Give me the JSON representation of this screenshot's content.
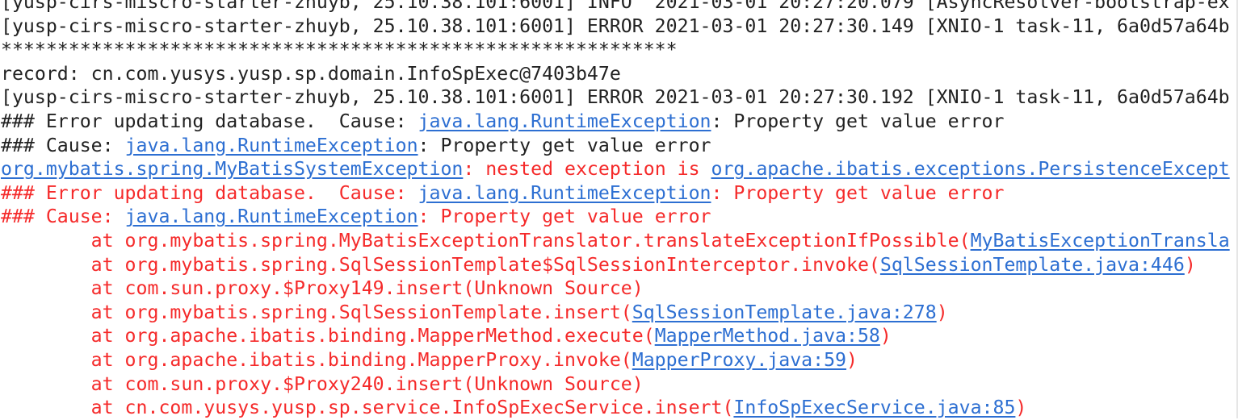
{
  "colors": {
    "normal": "#222222",
    "error": "#f52a2a",
    "link": "#2d6fd2"
  },
  "console": {
    "lines": [
      [
        {
          "t": "[yusp-cirs-miscro-starter-zhuyb, 25.10.38.101:6001] INFO  2021-03-01 20:27:20.079 [AsyncResolver-bootstrap-ex",
          "c": "n"
        }
      ],
      [
        {
          "t": "[yusp-cirs-miscro-starter-zhuyb, 25.10.38.101:6001] ERROR 2021-03-01 20:27:30.149 [XNIO-1 task-11, 6a0d57a64b",
          "c": "n"
        }
      ],
      [
        {
          "t": "************************************************************",
          "c": "n"
        }
      ],
      [
        {
          "t": "record: cn.com.yusys.yusp.sp.domain.InfoSpExec@7403b47e",
          "c": "n"
        }
      ],
      [
        {
          "t": "[yusp-cirs-miscro-starter-zhuyb, 25.10.38.101:6001] ERROR 2021-03-01 20:27:30.192 [XNIO-1 task-11, 6a0d57a64b",
          "c": "n"
        }
      ],
      [
        {
          "t": "### Error updating database.  Cause: ",
          "c": "n"
        },
        {
          "t": "java.lang.RuntimeException",
          "c": "l"
        },
        {
          "t": ": Property get value error",
          "c": "n"
        }
      ],
      [
        {
          "t": "### Cause: ",
          "c": "n"
        },
        {
          "t": "java.lang.RuntimeException",
          "c": "l"
        },
        {
          "t": ": Property get value error",
          "c": "n"
        }
      ],
      [
        {
          "t": "org.mybatis.spring.MyBatisSystemException",
          "c": "l"
        },
        {
          "t": ": nested exception is ",
          "c": "e"
        },
        {
          "t": "org.apache.ibatis.exceptions.PersistenceExcept",
          "c": "l"
        }
      ],
      [
        {
          "t": "### Error updating database.  Cause: ",
          "c": "e"
        },
        {
          "t": "java.lang.RuntimeException",
          "c": "l"
        },
        {
          "t": ": Property get value error",
          "c": "e"
        }
      ],
      [
        {
          "t": "### Cause: ",
          "c": "e"
        },
        {
          "t": "java.lang.RuntimeException",
          "c": "l"
        },
        {
          "t": ": Property get value error",
          "c": "e"
        }
      ],
      [
        {
          "t": "        at org.mybatis.spring.MyBatisExceptionTranslator.translateExceptionIfPossible(",
          "c": "e"
        },
        {
          "t": "MyBatisExceptionTransla",
          "c": "l"
        }
      ],
      [
        {
          "t": "        at org.mybatis.spring.SqlSessionTemplate$SqlSessionInterceptor.invoke(",
          "c": "e"
        },
        {
          "t": "SqlSessionTemplate.java:446",
          "c": "l"
        },
        {
          "t": ")",
          "c": "e"
        }
      ],
      [
        {
          "t": "        at com.sun.proxy.$Proxy149.insert(Unknown Source)",
          "c": "e"
        }
      ],
      [
        {
          "t": "        at org.mybatis.spring.SqlSessionTemplate.insert(",
          "c": "e"
        },
        {
          "t": "SqlSessionTemplate.java:278",
          "c": "l"
        },
        {
          "t": ")",
          "c": "e"
        }
      ],
      [
        {
          "t": "        at org.apache.ibatis.binding.MapperMethod.execute(",
          "c": "e"
        },
        {
          "t": "MapperMethod.java:58",
          "c": "l"
        },
        {
          "t": ")",
          "c": "e"
        }
      ],
      [
        {
          "t": "        at org.apache.ibatis.binding.MapperProxy.invoke(",
          "c": "e"
        },
        {
          "t": "MapperProxy.java:59",
          "c": "l"
        },
        {
          "t": ")",
          "c": "e"
        }
      ],
      [
        {
          "t": "        at com.sun.proxy.$Proxy240.insert(Unknown Source)",
          "c": "e"
        }
      ],
      [
        {
          "t": "        at cn.com.yusys.yusp.sp.service.InfoSpExecService.insert(",
          "c": "e"
        },
        {
          "t": "InfoSpExecService.java:85",
          "c": "l"
        },
        {
          "t": ")",
          "c": "e"
        }
      ]
    ]
  }
}
